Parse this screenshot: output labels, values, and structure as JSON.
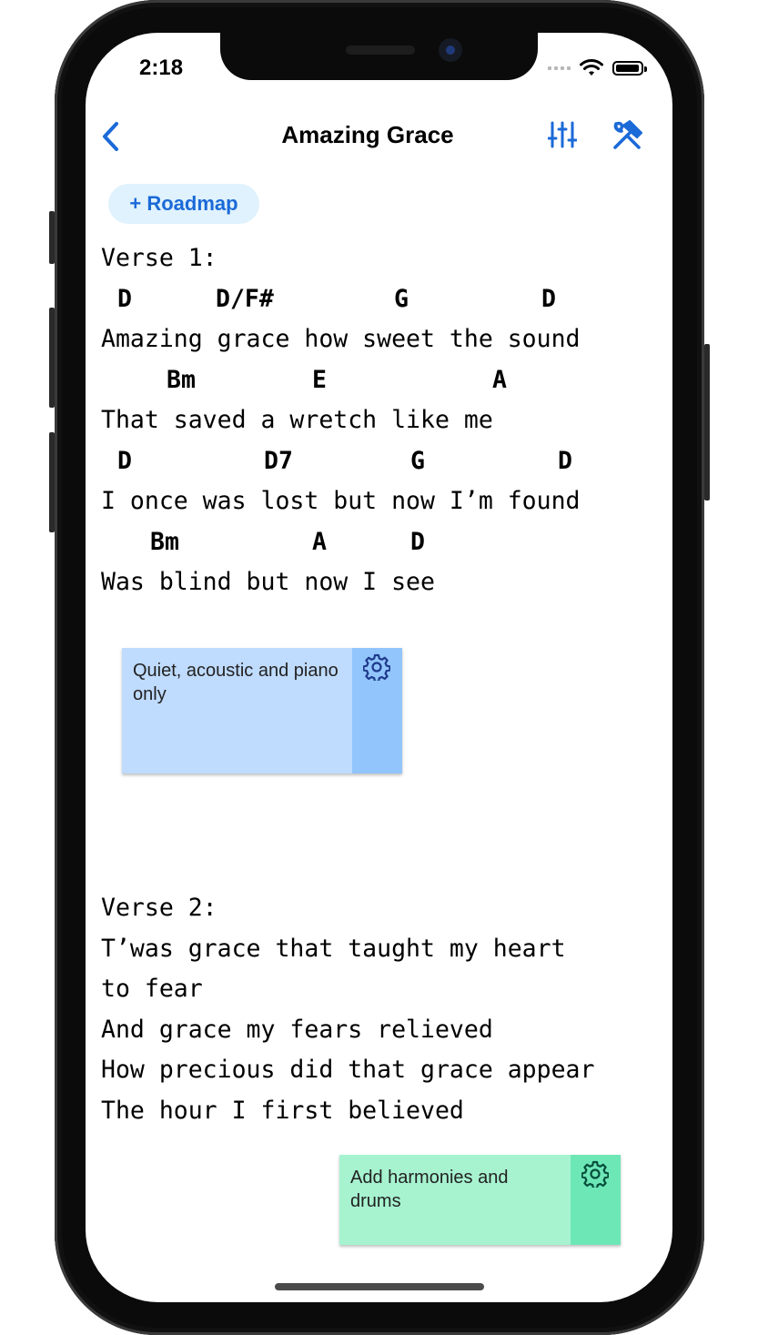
{
  "status_bar": {
    "time": "2:18"
  },
  "nav": {
    "title": "Amazing Grace"
  },
  "roadmap_button": {
    "label": "+ Roadmap"
  },
  "verse1": {
    "heading": "Verse 1:",
    "lines": [
      "Amazing grace how sweet the sound",
      "That saved a wretch like me",
      "I once was lost but now I’m found",
      "Was blind but now I see"
    ],
    "chords": [
      [
        "D",
        "D/F#",
        "G",
        "D"
      ],
      [
        "Bm",
        "E",
        "A"
      ],
      [
        "D",
        "D7",
        "G",
        "D"
      ],
      [
        "Bm",
        "A",
        "D"
      ]
    ]
  },
  "note1": {
    "text": "Quiet, acoustic and piano only"
  },
  "verse2": {
    "heading": "Verse 2:",
    "lines": [
      "T’was grace that taught my heart",
      "to fear",
      "And grace my fears relieved",
      "How precious did that grace appear",
      "The hour I first believed"
    ]
  },
  "note2": {
    "text": "Add harmonies and drums"
  },
  "colors": {
    "accent": "#1b6ad8",
    "note1_body": "#bfdbfe",
    "note1_side": "#93c5fd",
    "note2_body": "#a7f3d0",
    "note2_side": "#6ee7b7",
    "roadmap_bg": "#e0f2fd"
  }
}
